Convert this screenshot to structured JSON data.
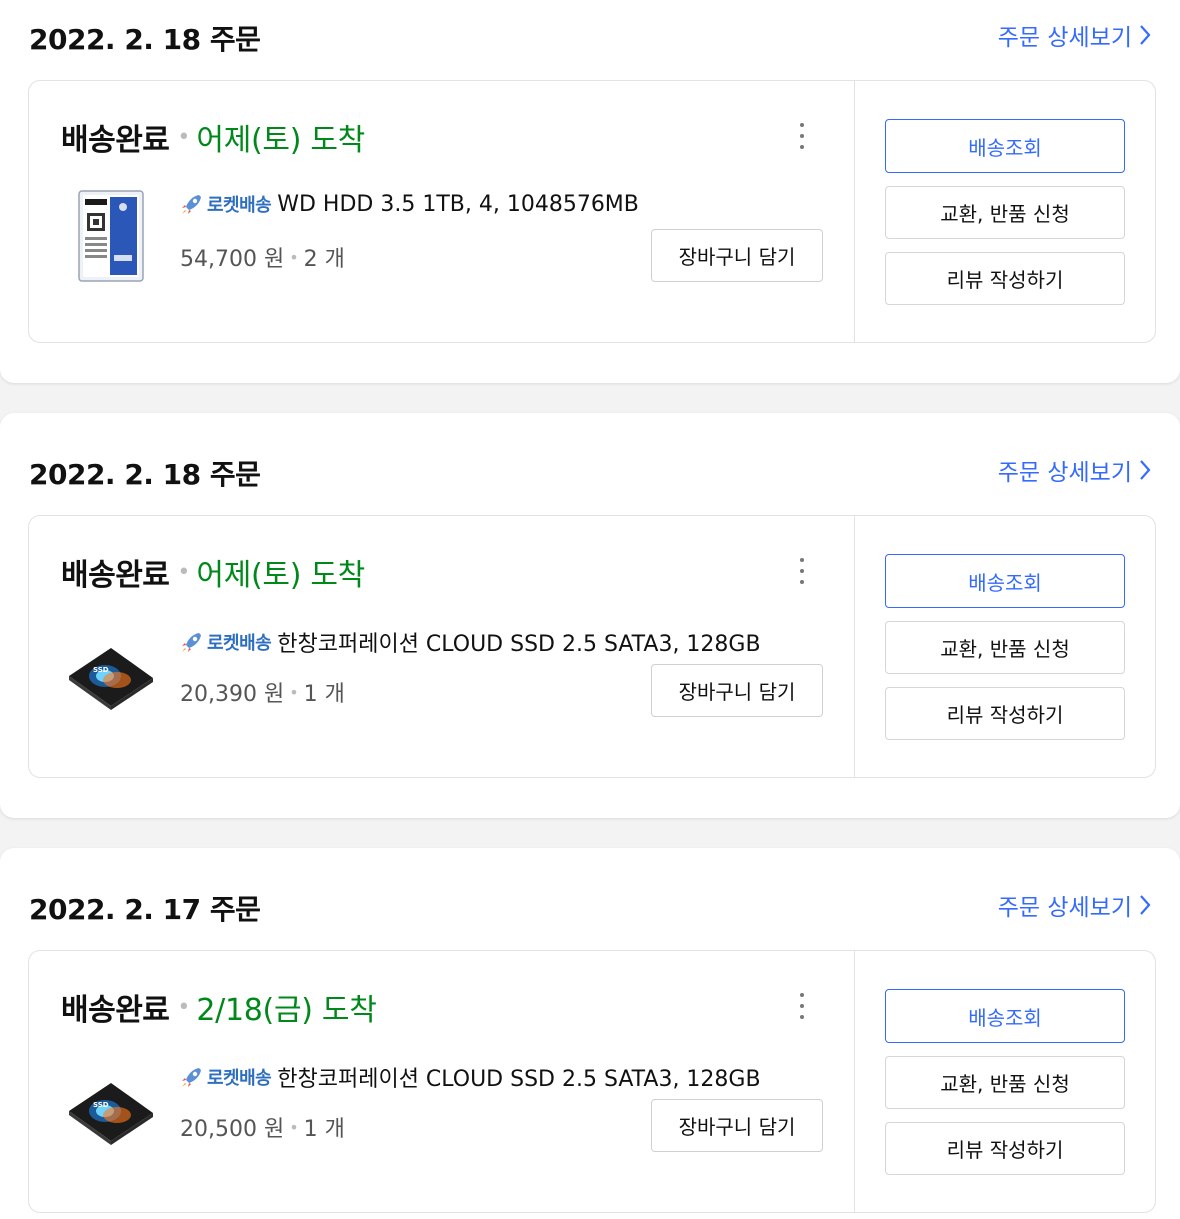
{
  "colors": {
    "link": "#346aff",
    "arrival": "#00891a",
    "rocket": "#2f6fc0"
  },
  "orders": [
    {
      "date": "2022. 2. 18 주문",
      "detail_link": "주문 상세보기",
      "status": "배송완료",
      "arrival": "어제(토) 도착",
      "rocket_label": "로켓배송",
      "product_name": "WD HDD 3.5 1TB, 4, 1048576MB",
      "price": "54,700 원",
      "quantity": "2 개",
      "thumbnail": "hdd-image",
      "cart_button": "장바구니 담기",
      "track_button": "배송조회",
      "exchange_button": "교환, 반품 신청",
      "review_button": "리뷰 작성하기"
    },
    {
      "date": "2022. 2. 18 주문",
      "detail_link": "주문 상세보기",
      "status": "배송완료",
      "arrival": "어제(토) 도착",
      "rocket_label": "로켓배송",
      "product_name": "한창코퍼레이션 CLOUD SSD 2.5 SATA3, 128GB",
      "price": "20,390 원",
      "quantity": "1 개",
      "thumbnail": "ssd-image",
      "cart_button": "장바구니 담기",
      "track_button": "배송조회",
      "exchange_button": "교환, 반품 신청",
      "review_button": "리뷰 작성하기"
    },
    {
      "date": "2022. 2. 17 주문",
      "detail_link": "주문 상세보기",
      "status": "배송완료",
      "arrival": "2/18(금) 도착",
      "rocket_label": "로켓배송",
      "product_name": "한창코퍼레이션 CLOUD SSD 2.5 SATA3, 128GB",
      "price": "20,500 원",
      "quantity": "1 개",
      "thumbnail": "ssd-image",
      "cart_button": "장바구니 담기",
      "track_button": "배송조회",
      "exchange_button": "교환, 반품 신청",
      "review_button": "리뷰 작성하기"
    }
  ]
}
